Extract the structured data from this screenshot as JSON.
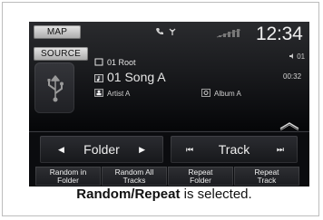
{
  "screen": {
    "map_label": "MAP",
    "source_label": "SOURCE",
    "clock": "12:34",
    "track_number": "01",
    "folder_path": "01 Root",
    "song_title": "01 Song A",
    "elapsed_time": "00:32",
    "artist": "Artist A",
    "album": "Album A",
    "controls": {
      "folder_label": "Folder",
      "track_label": "Track"
    },
    "mode_buttons": [
      {
        "line1": "Random in",
        "line2": "Folder"
      },
      {
        "line1": "Random All",
        "line2": "Tracks"
      },
      {
        "line1": "Repeat",
        "line2": "Folder"
      },
      {
        "line1": "Repeat",
        "line2": "Track"
      }
    ]
  },
  "caption": {
    "bold": "Random/Repeat",
    "rest": " is selected."
  },
  "colors": {
    "screen_background": "#0b0c0f",
    "button_text": "#efefef",
    "caption_text": "#111111"
  },
  "icons": {
    "status_phone": "phone-icon",
    "status_antenna": "antenna-icon",
    "signal": "signal-icon",
    "usb": "usb-icon",
    "folder": "folder-icon",
    "song": "music-note-icon",
    "artist": "artist-icon",
    "album": "album-icon",
    "scroll": "scroll-up-icon"
  }
}
